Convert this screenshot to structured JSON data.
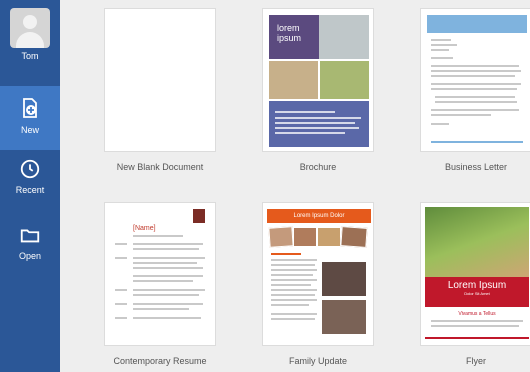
{
  "sidebar": {
    "user": {
      "name": "Tom"
    },
    "items": [
      {
        "label": "New",
        "icon": "new-document-icon",
        "active": true
      },
      {
        "label": "Recent",
        "icon": "clock-icon",
        "active": false
      },
      {
        "label": "Open",
        "icon": "folder-icon",
        "active": false
      }
    ]
  },
  "templates": [
    {
      "label": "New Blank Document"
    },
    {
      "label": "Brochure",
      "preview_title": "lorem ipsum"
    },
    {
      "label": "Business Letter"
    },
    {
      "label": "Contemporary Resume",
      "preview_name": "[Name]"
    },
    {
      "label": "Family Update",
      "preview_title": "Lorem Ipsum Dolor"
    },
    {
      "label": "Flyer",
      "preview_title": "Lorem Ipsum",
      "preview_subtitle": "Dolor Sit Amet",
      "preview_footer": "Vivamus a Tellus"
    }
  ],
  "colors": {
    "sidebar": "#2b5797",
    "sidebar_active": "#3f78c4",
    "brochure_purple": "#5b4a7f",
    "family_orange": "#e55a1c",
    "flyer_red": "#c0182b"
  }
}
